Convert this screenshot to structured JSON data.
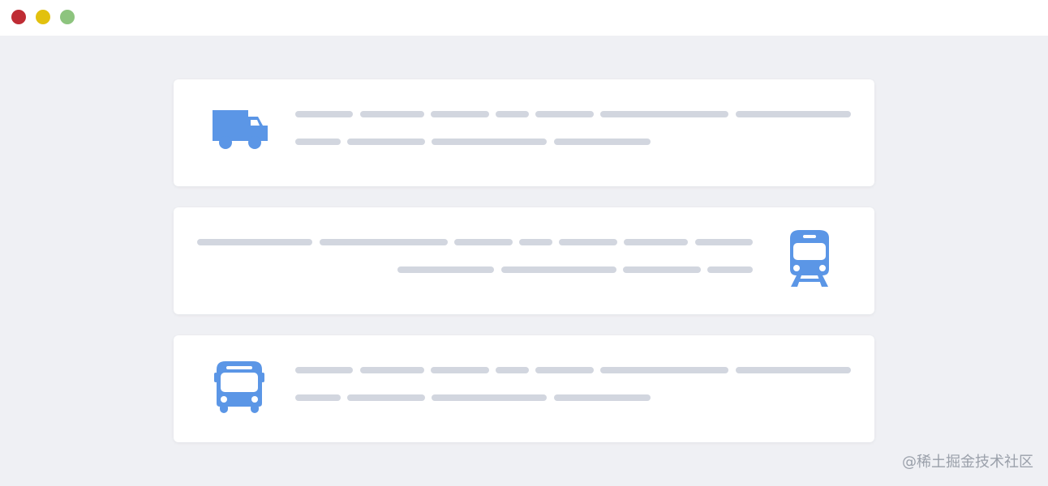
{
  "window": {
    "controls": [
      "close",
      "minimize",
      "maximize"
    ],
    "colors": {
      "close": "#bf2c34",
      "minimize": "#e2c10e",
      "maximize": "#8dc47e",
      "background": "#eff0f4",
      "card": "#ffffff",
      "icon": "#5b96e6",
      "placeholder_bar": "#d2d6df"
    }
  },
  "cards": [
    {
      "icon": "truck-icon",
      "icon_side": "left",
      "content": "skeleton-text",
      "lines": 2
    },
    {
      "icon": "train-icon",
      "icon_side": "right",
      "content": "skeleton-text",
      "lines": 2
    },
    {
      "icon": "bus-icon",
      "icon_side": "left",
      "content": "skeleton-text",
      "lines": 2
    }
  ],
  "watermark": "@稀土掘金技术社区"
}
